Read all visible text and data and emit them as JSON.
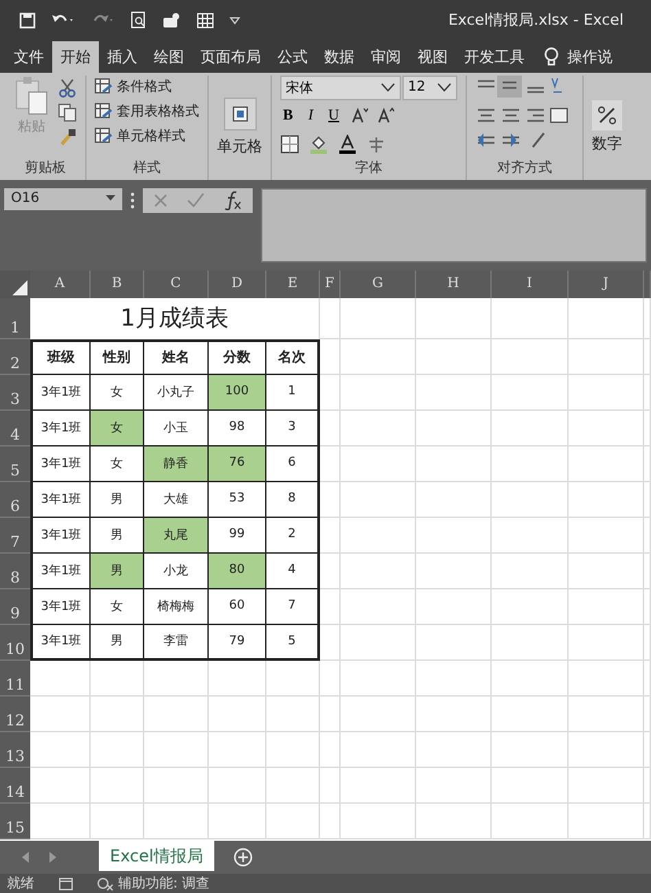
{
  "window": {
    "title": "Excel情报局.xlsx  -  Excel"
  },
  "tabs": [
    {
      "label": "文件",
      "selected": false
    },
    {
      "label": "开始",
      "selected": true
    },
    {
      "label": "插入",
      "selected": false
    },
    {
      "label": "绘图",
      "selected": false
    },
    {
      "label": "页面布局",
      "selected": false
    },
    {
      "label": "公式",
      "selected": false
    },
    {
      "label": "数据",
      "selected": false
    },
    {
      "label": "审阅",
      "selected": false
    },
    {
      "label": "视图",
      "selected": false
    },
    {
      "label": "开发工具",
      "selected": false
    }
  ],
  "tell_me": "操作说",
  "ribbon": {
    "paste_label": "粘贴",
    "clipboard_group": "剪贴板",
    "style_items": [
      "条件格式",
      "套用表格格式",
      "单元格样式"
    ],
    "styles_group": "样式",
    "cells_label": "单元格",
    "font_name": "宋体",
    "font_size": "12",
    "bold": "B",
    "italic": "I",
    "underline": "U",
    "font_group": "字体",
    "align_group": "对齐方式",
    "number_label": "数字"
  },
  "formula_bar": {
    "name_box": "O16"
  },
  "columns": [
    "A",
    "B",
    "C",
    "D",
    "E",
    "F",
    "G",
    "H",
    "I",
    "J"
  ],
  "row_numbers": [
    "1",
    "2",
    "3",
    "4",
    "5",
    "6",
    "7",
    "8",
    "9",
    "10",
    "11",
    "12",
    "13",
    "14",
    "15"
  ],
  "table": {
    "title": "1月成绩表",
    "headers": [
      "班级",
      "性别",
      "姓名",
      "分数",
      "名次"
    ],
    "rows": [
      [
        {
          "text": "3年1班",
          "highlighted": false
        },
        {
          "text": "女",
          "highlighted": false
        },
        {
          "text": "小丸子",
          "highlighted": false
        },
        {
          "text": "100",
          "highlighted": true
        },
        {
          "text": "1",
          "highlighted": false
        }
      ],
      [
        {
          "text": "3年1班",
          "highlighted": false
        },
        {
          "text": "女",
          "highlighted": true
        },
        {
          "text": "小玉",
          "highlighted": false
        },
        {
          "text": "98",
          "highlighted": false
        },
        {
          "text": "3",
          "highlighted": false
        }
      ],
      [
        {
          "text": "3年1班",
          "highlighted": false
        },
        {
          "text": "女",
          "highlighted": false
        },
        {
          "text": "静香",
          "highlighted": true
        },
        {
          "text": "76",
          "highlighted": true
        },
        {
          "text": "6",
          "highlighted": false
        }
      ],
      [
        {
          "text": "3年1班",
          "highlighted": false
        },
        {
          "text": "男",
          "highlighted": false
        },
        {
          "text": "大雄",
          "highlighted": false
        },
        {
          "text": "53",
          "highlighted": false
        },
        {
          "text": "8",
          "highlighted": false
        }
      ],
      [
        {
          "text": "3年1班",
          "highlighted": false
        },
        {
          "text": "男",
          "highlighted": false
        },
        {
          "text": "丸尾",
          "highlighted": true
        },
        {
          "text": "99",
          "highlighted": false
        },
        {
          "text": "2",
          "highlighted": false
        }
      ],
      [
        {
          "text": "3年1班",
          "highlighted": false
        },
        {
          "text": "男",
          "highlighted": true
        },
        {
          "text": "小龙",
          "highlighted": false
        },
        {
          "text": "80",
          "highlighted": true
        },
        {
          "text": "4",
          "highlighted": false
        }
      ],
      [
        {
          "text": "3年1班",
          "highlighted": false
        },
        {
          "text": "女",
          "highlighted": false
        },
        {
          "text": "椅梅梅",
          "highlighted": false
        },
        {
          "text": "60",
          "highlighted": false
        },
        {
          "text": "7",
          "highlighted": false
        }
      ],
      [
        {
          "text": "3年1班",
          "highlighted": false
        },
        {
          "text": "男",
          "highlighted": false
        },
        {
          "text": "李雷",
          "highlighted": false
        },
        {
          "text": "79",
          "highlighted": false
        },
        {
          "text": "5",
          "highlighted": false
        }
      ]
    ]
  },
  "sheet_tabs": [
    {
      "label": "Excel情报局",
      "selected": true
    }
  ],
  "status_bar": {
    "ready": "就绪",
    "accessibility": "辅助功能: 调查"
  }
}
